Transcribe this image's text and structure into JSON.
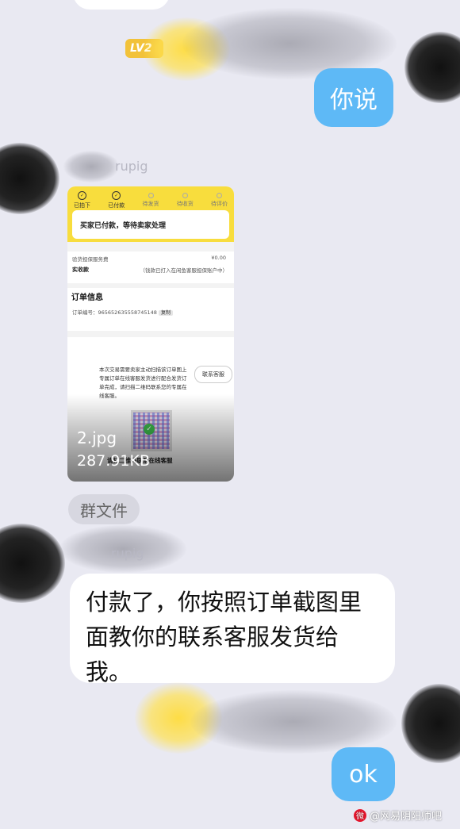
{
  "chat": {
    "my_message_1": "你说",
    "my_message_2": "ok",
    "other_message": "付款了，你按照订单截图里面教你的联系客服发货给我。",
    "level_badge": "LV2",
    "sender_name_partial": "rupig",
    "group_file_label": "群文件"
  },
  "file_card": {
    "file_name": "2.jpg",
    "file_size": "287.91KB",
    "steps": [
      "已拍下",
      "已付款",
      "待发货",
      "待收货",
      "待评价"
    ],
    "status_title": "买家已付款，等待卖家处理",
    "service_fee_label": "验货担保服务费",
    "service_fee_value": "¥0.00",
    "received_label": "实收款",
    "received_note": "（钱款已打入在闲鱼客服担保账户中）",
    "order_info_title": "订单信息",
    "order_number_label": "订单编号：",
    "order_number": "965652635558745148",
    "copy_label": "复制",
    "notice_text": "本次交易需要卖家主动扫描该订单图上专属订单在线客服发货进行配合发货订单完成，请扫描二维码联系您的专属在线客服。",
    "contact_button": "联系客服",
    "qr_caption": "请扫二维码联系在线客服"
  },
  "watermark": {
    "text": "@网易阴阳师吧"
  },
  "colors": {
    "my_bubble": "#5eb9f6",
    "other_bubble": "#ffffff",
    "background": "#e9e9f2",
    "badge": "#f2c23a",
    "order_header": "#f8dd3d"
  }
}
